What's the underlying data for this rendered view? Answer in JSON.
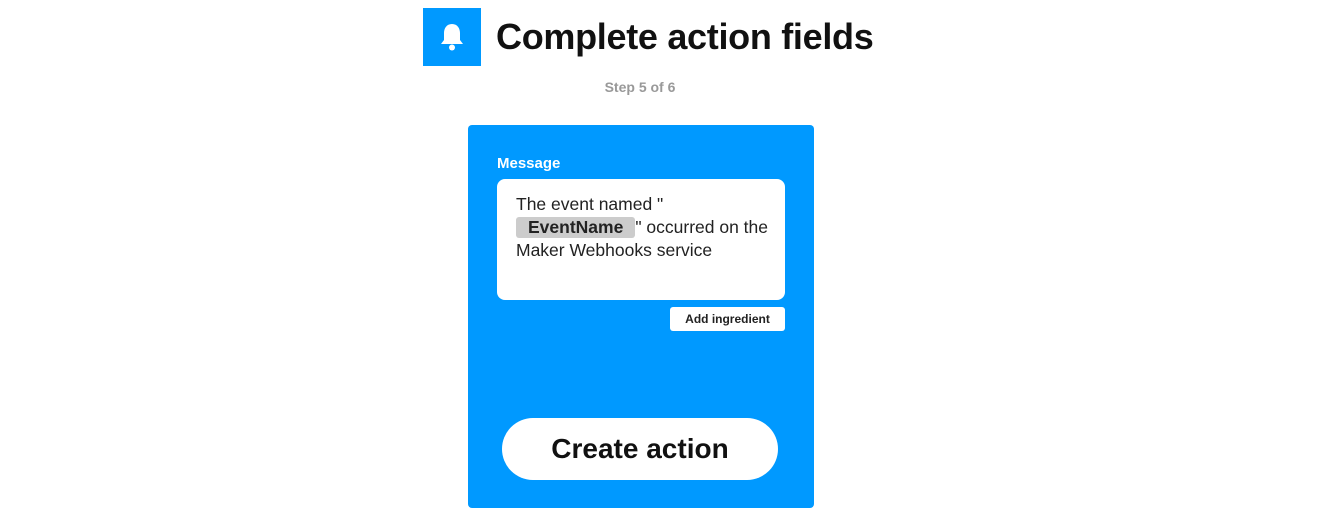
{
  "header": {
    "title": "Complete action fields",
    "icon": "bell-icon",
    "icon_color": "#0099ff"
  },
  "step": {
    "text": "Step 5 of 6"
  },
  "card": {
    "background_color": "#0099ff",
    "field_label": "Message",
    "message": {
      "before": "The event named \"",
      "ingredient": "EventName",
      "after": "\" occurred on the Maker Webhooks service"
    },
    "add_ingredient_label": "Add ingredient",
    "create_action_label": "Create action"
  }
}
